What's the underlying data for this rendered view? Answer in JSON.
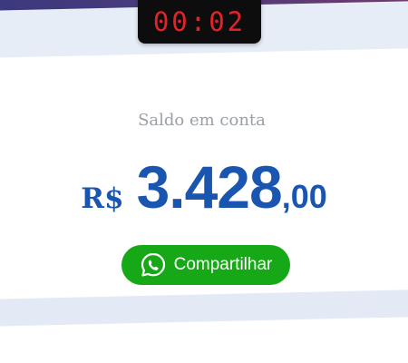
{
  "timer": {
    "text": "00:02"
  },
  "balance": {
    "label": "Saldo em conta",
    "currency": "R$",
    "integer": "3.428",
    "cents": ",00"
  },
  "share": {
    "label": "Compartilhar",
    "icon": "whatsapp-icon"
  },
  "colors": {
    "accent": "#1a56b0",
    "whatsapp_green": "#17a817",
    "timer_red": "#e3222a",
    "top_gradient_start": "#3a3a7e",
    "top_gradient_end": "#7a3a6a",
    "band_light": "#e7edf7"
  }
}
